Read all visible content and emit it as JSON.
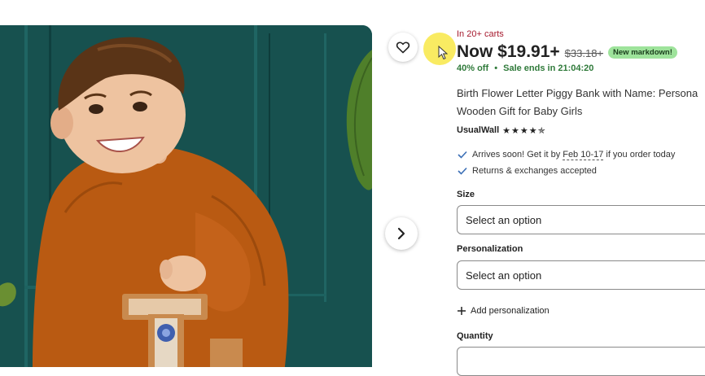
{
  "listing": {
    "cart_notice": "In 20+ carts",
    "price_now": "Now $19.91+",
    "price_old": "$33.18+",
    "markdown_badge": "New markdown!",
    "discount": "40% off",
    "separator": "•",
    "sale_ends": "Sale ends in 21:04:20",
    "title_line1": "Birth Flower Letter Piggy Bank with Name: Persona",
    "title_line2": "Wooden Gift for Baby Girls",
    "shop_name": "UsualWall",
    "rating_stars": "★★★★✯",
    "arrival_prefix": "Arrives soon! Get it by",
    "arrival_dates": "Feb 10-17",
    "arrival_suffix": "if you order today",
    "returns": "Returns & exchanges accepted"
  },
  "options": {
    "size_label": "Size",
    "size_value": "Select an option",
    "personalization_label": "Personalization",
    "personalization_value": "Select an option",
    "add_personalization": "Add personalization",
    "quantity_label": "Quantity"
  },
  "icons": {
    "favorite": "heart-icon",
    "next": "chevron-right-icon",
    "check": "check-icon",
    "plus": "plus-icon"
  },
  "colors": {
    "cart_notice": "#a61a2e",
    "sale": "#2f7a3a",
    "badge_bg": "#9ee39b",
    "photo_bg": "#16504f"
  }
}
